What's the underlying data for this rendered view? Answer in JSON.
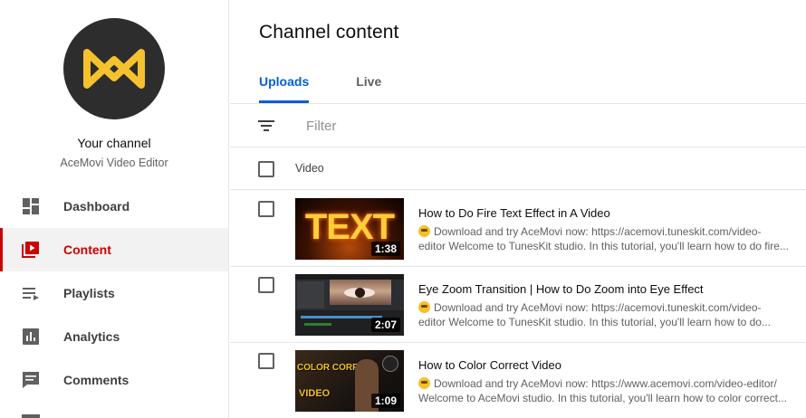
{
  "sidebar": {
    "your_channel_label": "Your channel",
    "channel_name": "AceMovi Video Editor",
    "items": [
      {
        "label": "Dashboard",
        "icon": "dashboard-icon",
        "active": false
      },
      {
        "label": "Content",
        "icon": "content-icon",
        "active": true
      },
      {
        "label": "Playlists",
        "icon": "playlists-icon",
        "active": false
      },
      {
        "label": "Analytics",
        "icon": "analytics-icon",
        "active": false
      },
      {
        "label": "Comments",
        "icon": "comments-icon",
        "active": false
      }
    ]
  },
  "main": {
    "title": "Channel content",
    "tabs": [
      {
        "label": "Uploads",
        "active": true
      },
      {
        "label": "Live",
        "active": false
      }
    ],
    "filter": {
      "placeholder": "Filter"
    },
    "table": {
      "column_header": "Video",
      "rows": [
        {
          "title": "How to Do Fire Text Effect in A Video",
          "desc_line1": "Download and try AceMovi now: https://acemovi.tuneskit.com/video-",
          "desc_line2": "editor Welcome to TunesKit studio. In this tutorial, you'll learn how to do fire...",
          "duration": "1:38",
          "thumb_text": "TEXT"
        },
        {
          "title": "Eye Zoom Transition | How to Do Zoom into Eye Effect",
          "desc_line1": "Download and try AceMovi now: https://acemovi.tuneskit.com/video-",
          "desc_line2": "editor Welcome to TunesKit studio. In this tutorial, you'll learn how to do...",
          "duration": "2:07"
        },
        {
          "title": "How to Color Correct Video",
          "desc_line1": "Download and try AceMovi now: https://www.acemovi.com/video-editor/",
          "desc_line2": "Welcome to AceMovi studio. In this tutorial, you'll learn how to color correct...",
          "duration": "1:09",
          "thumb_text1": "COLOR CORRECT",
          "thumb_text2": "VIDEO"
        }
      ]
    }
  },
  "colors": {
    "accent_red": "#cc0000",
    "accent_blue": "#065fd4",
    "logo_yellow": "#f5c12e",
    "avatar_bg": "#2d2d2d"
  }
}
